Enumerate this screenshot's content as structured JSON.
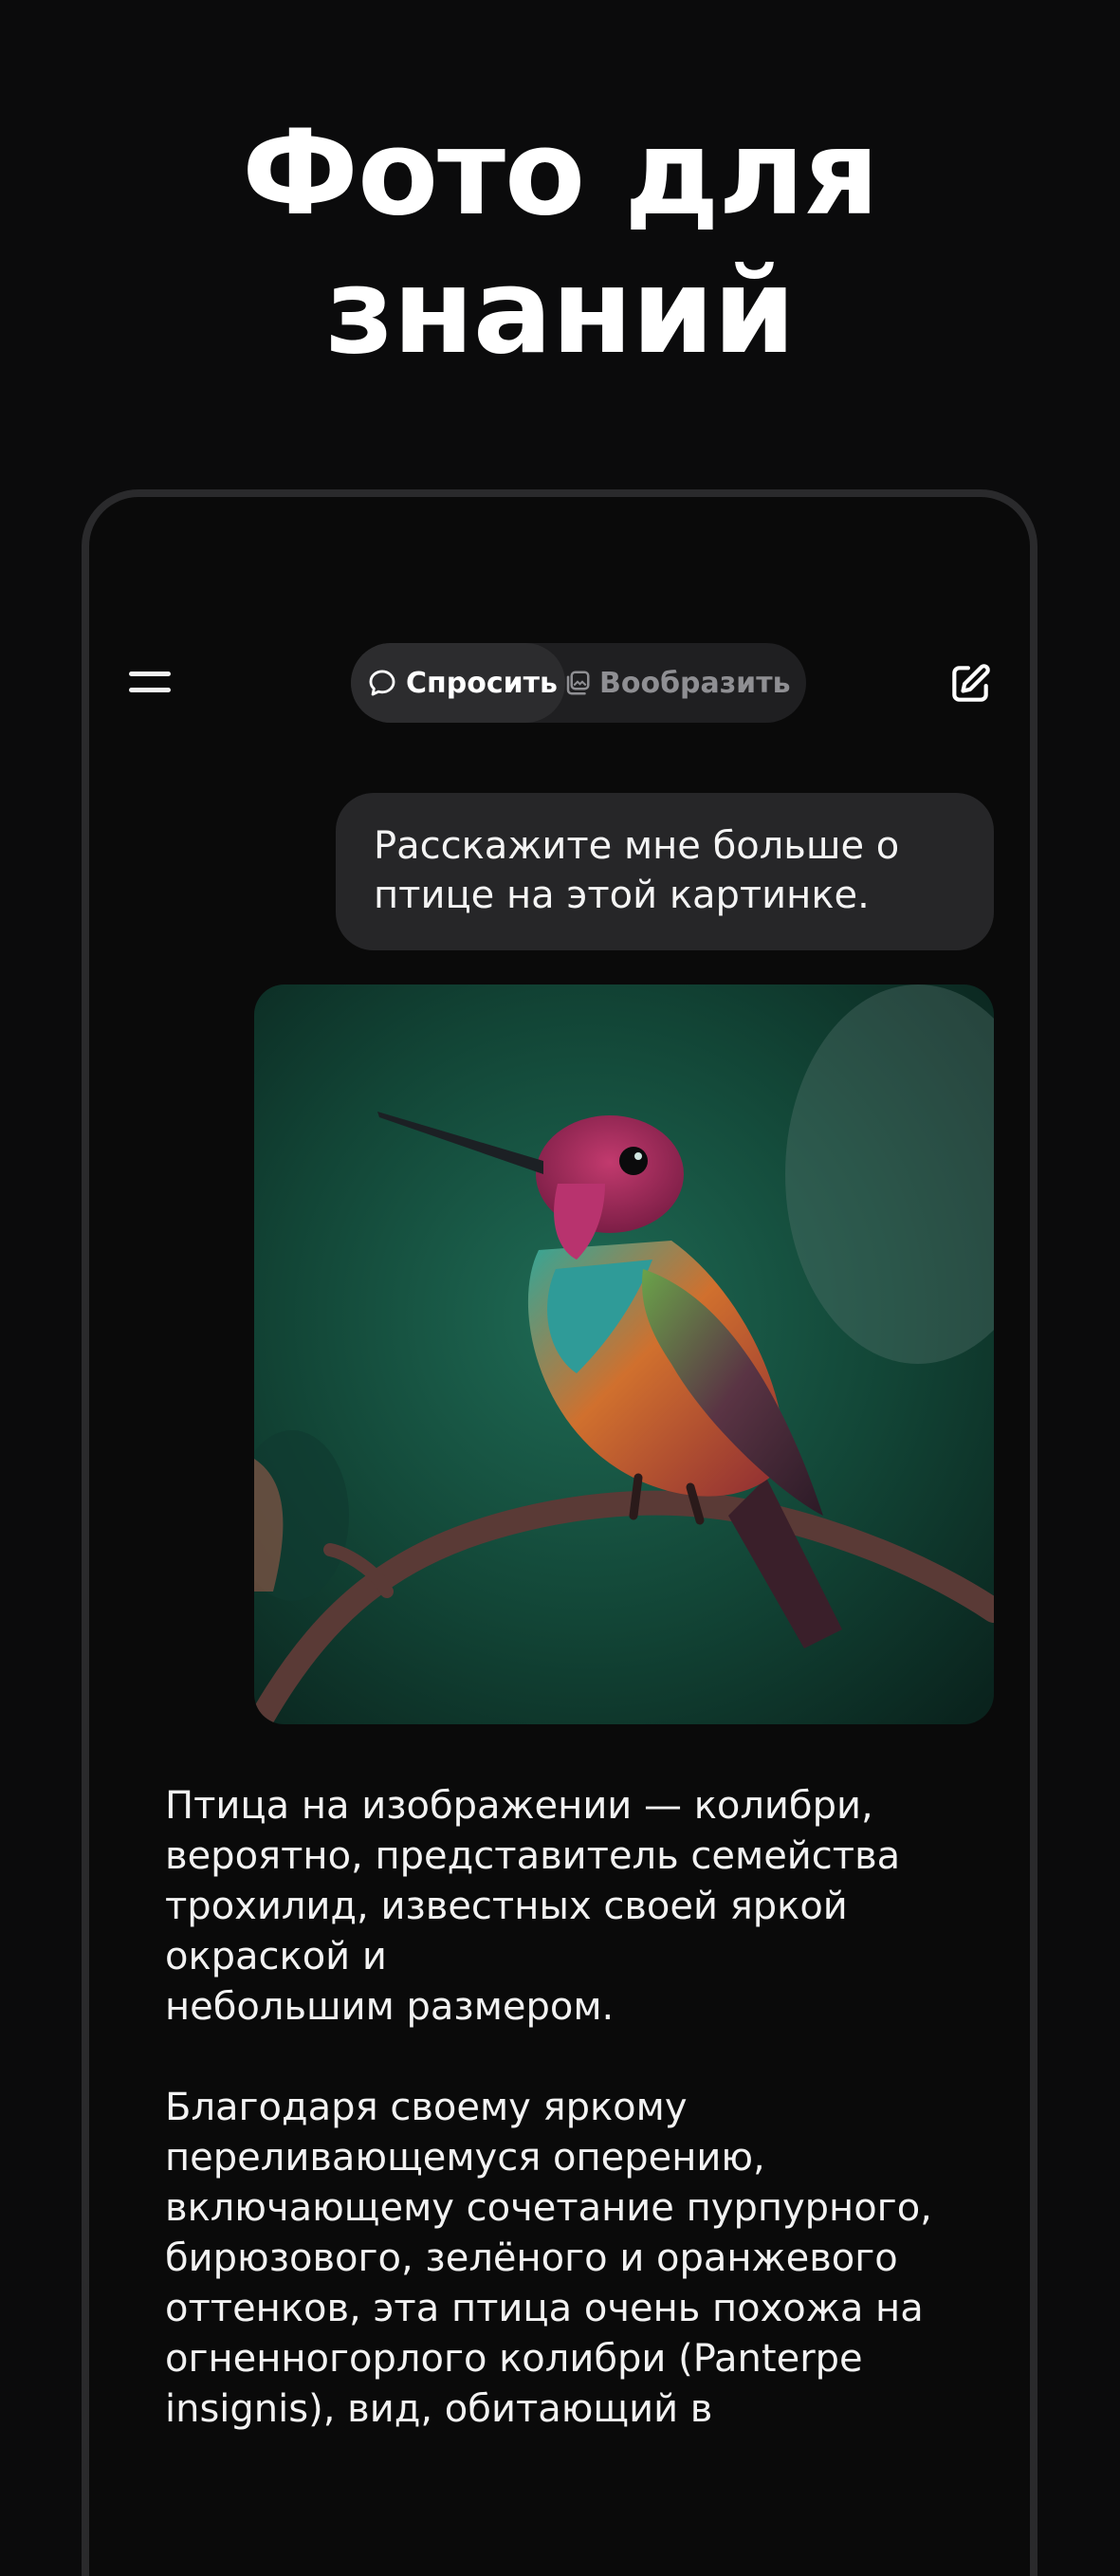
{
  "promo": {
    "headline_line1": "Фото для",
    "headline_line2": "знаний"
  },
  "app": {
    "topbar": {
      "menu_icon": "hamburger-menu-icon",
      "tabs": [
        {
          "label": "Спросить",
          "icon": "chat-bubble-icon",
          "active": true
        },
        {
          "label": "Вообразить",
          "icon": "image-stack-icon",
          "active": false
        }
      ],
      "new_chat_icon": "compose-edit-icon"
    },
    "chat": {
      "user_message": "Расскажите мне больше о птице на этой картинке.",
      "attached_image": "hummingbird-photo",
      "answer_paragraphs": [
        "Птица на изображении — колибри,\nвероятно, представитель семейства\nтрохилид, известных своей яркой\nокраской и\nнебольшим размером.",
        "Благодаря своему яркому\nпереливающемуся оперению,\nвключающему сочетание пурпурного,\nбирюзового, зелёного и оранжевого\nоттенков, эта птица очень похожа на\nогненногорлого колибри (Panterpe\ninsignis), вид, обитающий в"
      ]
    }
  },
  "colors": {
    "background": "#0b0b0c",
    "user_bubble": "#262628",
    "segmented_bg": "#1f1f21",
    "active_tab": "#2c2c2e",
    "inactive_text": "#8f8f93"
  }
}
